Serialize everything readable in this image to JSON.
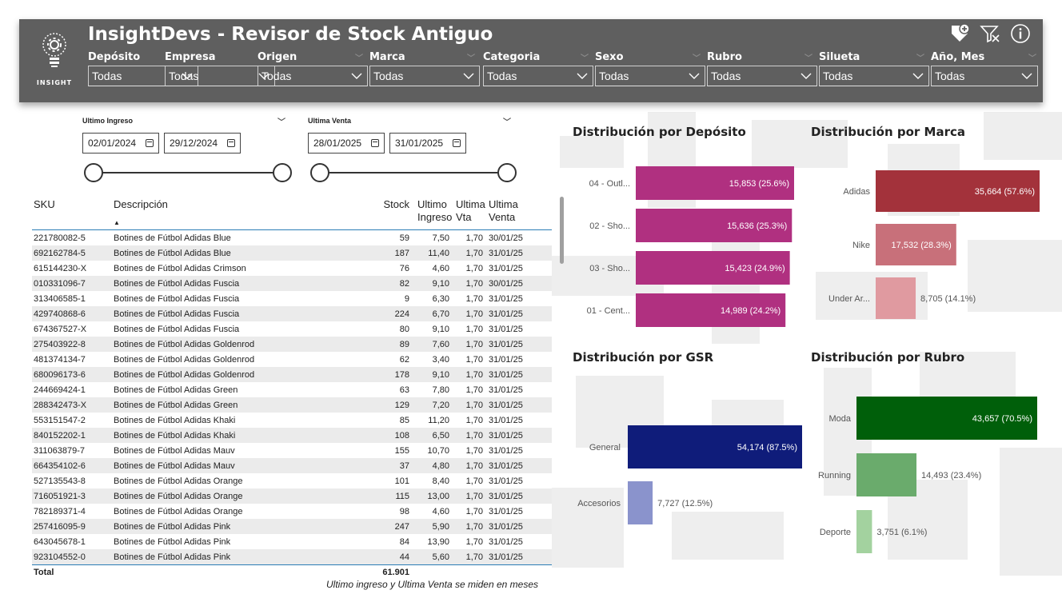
{
  "app": {
    "title": "InsightDevs - Revisor de Stock Antiguo",
    "logo_text": "INSIGHT"
  },
  "header_icons": [
    "add-tag-icon",
    "clear-filter-icon",
    "info-icon"
  ],
  "slicers": [
    {
      "label": "Depósito",
      "value": "Todas"
    },
    {
      "label": "Empresa",
      "value": "Todas"
    },
    {
      "label": "Origen",
      "value": "Todas"
    },
    {
      "label": "Marca",
      "value": "Todas"
    },
    {
      "label": "Categoria",
      "value": "Todas"
    },
    {
      "label": "Sexo",
      "value": "Todas"
    },
    {
      "label": "Rubro",
      "value": "Todas"
    },
    {
      "label": "Silueta",
      "value": "Todas"
    },
    {
      "label": "Año, Mes",
      "value": "Todas"
    }
  ],
  "date_filters": {
    "ingreso": {
      "label": "Ultimo Ingreso",
      "from": "02/01/2024",
      "to": "29/12/2024"
    },
    "venta": {
      "label": "Ultima Venta",
      "from": "28/01/2025",
      "to": "31/01/2025"
    }
  },
  "table": {
    "headers": {
      "sku": "SKU",
      "desc": "Descripción",
      "stock": "Stock",
      "ingreso": "Ultimo Ingreso",
      "vta": "Ultima Vta",
      "venta": "Ultima Venta"
    },
    "rows": [
      {
        "sku": "221780082-5",
        "desc": "Botines de Fútbol Adidas Blue",
        "stock": "59",
        "ingreso": "7,50",
        "vta": "1,70",
        "venta": "30/01/25"
      },
      {
        "sku": "692162784-5",
        "desc": "Botines de Fútbol Adidas Blue",
        "stock": "187",
        "ingreso": "11,40",
        "vta": "1,70",
        "venta": "31/01/25"
      },
      {
        "sku": "615144230-X",
        "desc": "Botines de Fútbol Adidas Crimson",
        "stock": "76",
        "ingreso": "4,60",
        "vta": "1,70",
        "venta": "31/01/25"
      },
      {
        "sku": "010331096-7",
        "desc": "Botines de Fútbol Adidas Fuscia",
        "stock": "82",
        "ingreso": "9,10",
        "vta": "1,70",
        "venta": "30/01/25"
      },
      {
        "sku": "313406585-1",
        "desc": "Botines de Fútbol Adidas Fuscia",
        "stock": "9",
        "ingreso": "6,30",
        "vta": "1,70",
        "venta": "31/01/25"
      },
      {
        "sku": "429740868-6",
        "desc": "Botines de Fútbol Adidas Fuscia",
        "stock": "224",
        "ingreso": "6,70",
        "vta": "1,70",
        "venta": "31/01/25"
      },
      {
        "sku": "674367527-X",
        "desc": "Botines de Fútbol Adidas Fuscia",
        "stock": "80",
        "ingreso": "9,10",
        "vta": "1,70",
        "venta": "31/01/25"
      },
      {
        "sku": "275403922-8",
        "desc": "Botines de Fútbol Adidas Goldenrod",
        "stock": "89",
        "ingreso": "7,60",
        "vta": "1,70",
        "venta": "31/01/25"
      },
      {
        "sku": "481374134-7",
        "desc": "Botines de Fútbol Adidas Goldenrod",
        "stock": "62",
        "ingreso": "3,40",
        "vta": "1,70",
        "venta": "31/01/25"
      },
      {
        "sku": "680096173-6",
        "desc": "Botines de Fútbol Adidas Goldenrod",
        "stock": "178",
        "ingreso": "9,10",
        "vta": "1,70",
        "venta": "31/01/25"
      },
      {
        "sku": "244669424-1",
        "desc": "Botines de Fútbol Adidas Green",
        "stock": "63",
        "ingreso": "7,80",
        "vta": "1,70",
        "venta": "31/01/25"
      },
      {
        "sku": "288342473-X",
        "desc": "Botines de Fútbol Adidas Green",
        "stock": "129",
        "ingreso": "7,20",
        "vta": "1,70",
        "venta": "31/01/25"
      },
      {
        "sku": "553151547-2",
        "desc": "Botines de Fútbol Adidas Khaki",
        "stock": "85",
        "ingreso": "11,20",
        "vta": "1,70",
        "venta": "31/01/25"
      },
      {
        "sku": "840152202-1",
        "desc": "Botines de Fútbol Adidas Khaki",
        "stock": "108",
        "ingreso": "6,50",
        "vta": "1,70",
        "venta": "31/01/25"
      },
      {
        "sku": "311063879-7",
        "desc": "Botines de Fútbol Adidas Mauv",
        "stock": "155",
        "ingreso": "10,70",
        "vta": "1,70",
        "venta": "31/01/25"
      },
      {
        "sku": "664354102-6",
        "desc": "Botines de Fútbol Adidas Mauv",
        "stock": "37",
        "ingreso": "4,80",
        "vta": "1,70",
        "venta": "31/01/25"
      },
      {
        "sku": "527135543-8",
        "desc": "Botines de Fútbol Adidas Orange",
        "stock": "101",
        "ingreso": "8,40",
        "vta": "1,70",
        "venta": "31/01/25"
      },
      {
        "sku": "716051921-3",
        "desc": "Botines de Fútbol Adidas Orange",
        "stock": "115",
        "ingreso": "13,00",
        "vta": "1,70",
        "venta": "31/01/25"
      },
      {
        "sku": "782189371-4",
        "desc": "Botines de Fútbol Adidas Orange",
        "stock": "98",
        "ingreso": "4,60",
        "vta": "1,70",
        "venta": "31/01/25"
      },
      {
        "sku": "257416095-9",
        "desc": "Botines de Fútbol Adidas Pink",
        "stock": "247",
        "ingreso": "5,90",
        "vta": "1,70",
        "venta": "31/01/25"
      },
      {
        "sku": "643045678-1",
        "desc": "Botines de Fútbol Adidas Pink",
        "stock": "84",
        "ingreso": "13,90",
        "vta": "1,70",
        "venta": "31/01/25"
      },
      {
        "sku": "923104552-0",
        "desc": "Botines de Fútbol Adidas Pink",
        "stock": "44",
        "ingreso": "5,60",
        "vta": "1,70",
        "venta": "31/01/25"
      }
    ],
    "total_label": "Total",
    "total_stock": "61.901"
  },
  "footnote": "Ultimo ingreso y Ultima Venta se miden en meses",
  "chart_data": [
    {
      "type": "bar",
      "orientation": "horizontal",
      "title": "Distribución por Depósito",
      "categories": [
        "04 - Outl...",
        "02 - Sho...",
        "03 - Sho...",
        "01 - Cent..."
      ],
      "values": [
        15853,
        15636,
        15423,
        14989
      ],
      "labels": [
        "15,853 (25.6%)",
        "15,636 (25.3%)",
        "15,423 (24.9%)",
        "14,989 (24.2%)"
      ],
      "colors": [
        "#b03080",
        "#b03080",
        "#b03080",
        "#b03080"
      ]
    },
    {
      "type": "bar",
      "orientation": "horizontal",
      "title": "Distribución por Marca",
      "categories": [
        "Adidas",
        "Nike",
        "Under Ar..."
      ],
      "values": [
        35664,
        17532,
        8705
      ],
      "labels": [
        "35,664 (57.6%)",
        "17,532 (28.3%)",
        "8,705 (14.1%)"
      ],
      "colors": [
        "#a3323b",
        "#c8707a",
        "#e09aa0"
      ]
    },
    {
      "type": "bar",
      "orientation": "horizontal",
      "title": "Distribución por GSR",
      "categories": [
        "General",
        "Accesorios"
      ],
      "values": [
        54174,
        7727
      ],
      "labels": [
        "54,174 (87.5%)",
        "7,727 (12.5%)"
      ],
      "colors": [
        "#0f1c7a",
        "#8a93cc"
      ]
    },
    {
      "type": "bar",
      "orientation": "horizontal",
      "title": "Distribución por Rubro",
      "categories": [
        "Moda",
        "Running",
        "Deporte"
      ],
      "values": [
        43657,
        14493,
        3751
      ],
      "labels": [
        "43,657 (70.5%)",
        "14,493 (23.4%)",
        "3,751 (6.1%)"
      ],
      "colors": [
        "#005f0a",
        "#6aab6c",
        "#a3d29f"
      ]
    }
  ]
}
